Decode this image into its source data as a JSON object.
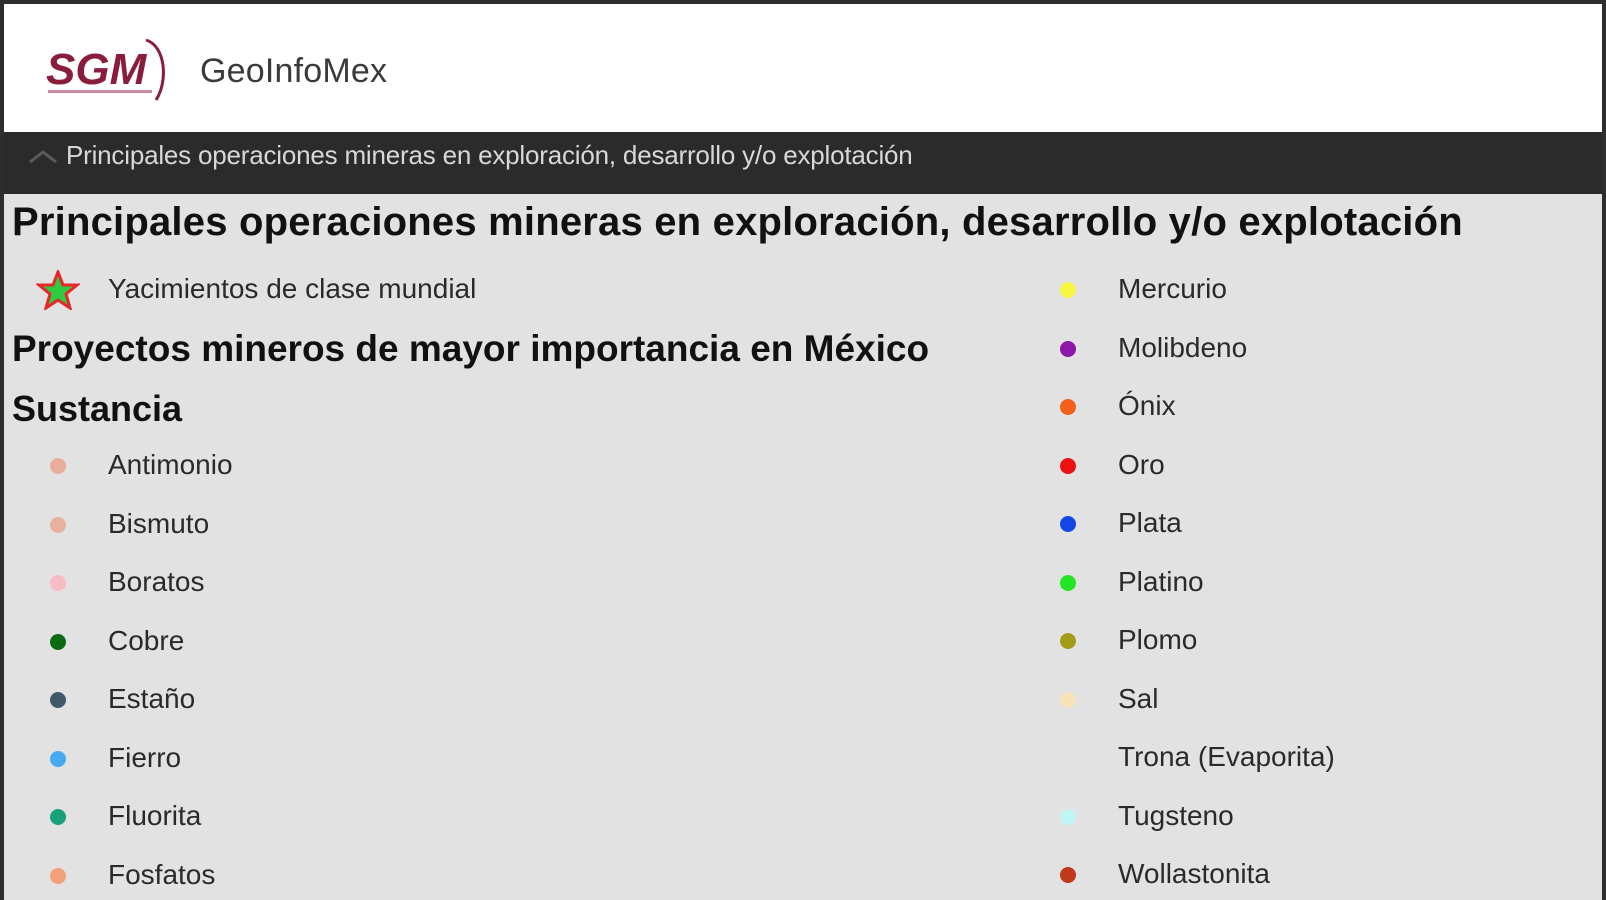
{
  "app": {
    "logo_text": "SGM",
    "title": "GeoInfoMex"
  },
  "layer_bar": {
    "label": "Principales operaciones mineras en exploración, desarrollo y/o explotación"
  },
  "legend": {
    "title": "Principales operaciones mineras en exploración, desarrollo y/o explotación",
    "world_class": {
      "label": "Yacimientos de clase mundial",
      "star_fill": "#2ecc40",
      "star_stroke": "#e8262a"
    },
    "projects_heading": "Proyectos mineros de mayor importancia en México",
    "substance_heading": "Sustancia",
    "left_items": [
      {
        "label": "Antimonio",
        "color": "#e8ae9a"
      },
      {
        "label": "Bismuto",
        "color": "#e8b09e"
      },
      {
        "label": "Boratos",
        "color": "#f7bcc4"
      },
      {
        "label": "Cobre",
        "color": "#0b6b12"
      },
      {
        "label": "Estaño",
        "color": "#3d5a66"
      },
      {
        "label": "Fierro",
        "color": "#45aaf2"
      },
      {
        "label": "Fluorita",
        "color": "#18a07a"
      },
      {
        "label": "Fosfatos",
        "color": "#f2a07a"
      }
    ],
    "right_items": [
      {
        "label": "Mercurio",
        "color": "#f5f542"
      },
      {
        "label": "Molibdeno",
        "color": "#8e16a8"
      },
      {
        "label": "Ónix",
        "color": "#f2601c"
      },
      {
        "label": "Oro",
        "color": "#ee1111"
      },
      {
        "label": "Plata",
        "color": "#1448e6"
      },
      {
        "label": "Platino",
        "color": "#22e622"
      },
      {
        "label": "Plomo",
        "color": "#a39c18"
      },
      {
        "label": "Sal",
        "color": "#f7e3b8"
      },
      {
        "label": "Trona (Evaporita)",
        "color": ""
      },
      {
        "label": "Tugsteno",
        "color": "#bff5f5"
      },
      {
        "label": "Wollastonita",
        "color": "#c0391b"
      }
    ]
  }
}
